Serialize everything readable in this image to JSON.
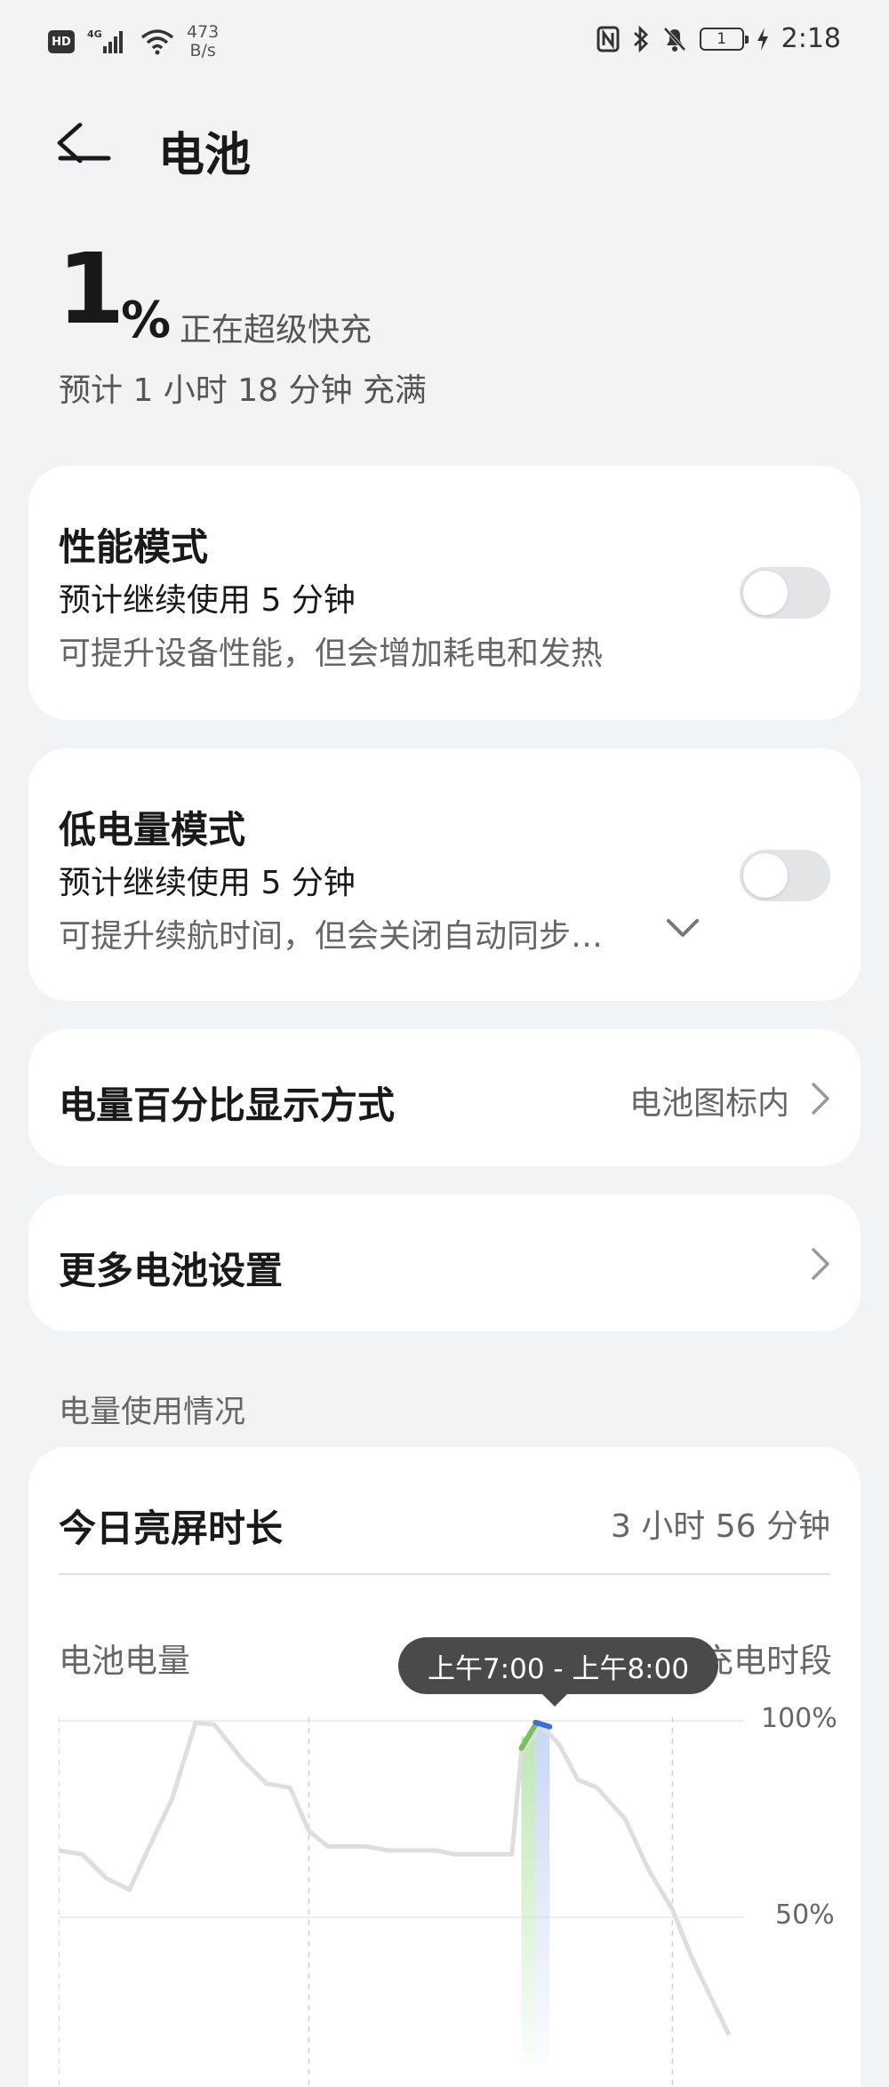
{
  "status_bar": {
    "hd": "HD",
    "network": "4G",
    "net_speed": "473",
    "net_speed_unit": "B/s",
    "battery_level": "1",
    "time": "2:18"
  },
  "header": {
    "title": "电池"
  },
  "battery": {
    "percent": "1",
    "percent_sign": "%",
    "status": "正在超级快充",
    "estimate": "预计 1 小时 18 分钟 充满"
  },
  "performance_mode": {
    "title": "性能模式",
    "subtitle": "预计继续使用 5 分钟",
    "description": "可提升设备性能，但会增加耗电和发热",
    "enabled": false
  },
  "low_power_mode": {
    "title": "低电量模式",
    "subtitle": "预计继续使用 5 分钟",
    "description": "可提升续航时间，但会关闭自动同步…",
    "enabled": false
  },
  "percent_display": {
    "title": "电量百分比显示方式",
    "value": "电池图标内"
  },
  "more_settings": {
    "title": "更多电池设置"
  },
  "usage_section": {
    "header": "电量使用情况",
    "screen_time_label": "今日亮屏时长",
    "screen_time_value": "3 小时 56 分钟"
  },
  "chart_data": {
    "type": "line",
    "title": "电池电量",
    "legend": [
      {
        "name": "充电时段",
        "color": "#bfe7b5"
      }
    ],
    "y_ticks": [
      "100%",
      "50%"
    ],
    "ylim": [
      0,
      100
    ],
    "tooltip": "上午7:00 - 上午8:00",
    "series": [
      {
        "values": [
          [
            0,
            67
          ],
          [
            0.5,
            66
          ],
          [
            1.0,
            60
          ],
          [
            1.5,
            57
          ],
          [
            2.0,
            70
          ],
          [
            2.4,
            80
          ],
          [
            2.9,
            99.5
          ],
          [
            3.3,
            99
          ],
          [
            3.9,
            90
          ],
          [
            4.4,
            84
          ],
          [
            4.9,
            83
          ],
          [
            5.3,
            72
          ],
          [
            5.7,
            68
          ],
          [
            6.2,
            68
          ],
          [
            6.5,
            68
          ],
          [
            7.0,
            67
          ],
          [
            7.5,
            67
          ],
          [
            8.0,
            67
          ],
          [
            8.4,
            66
          ],
          [
            9.0,
            66
          ],
          [
            9.6,
            66
          ],
          [
            9.8,
            92
          ],
          [
            10.2,
            99
          ],
          [
            10.6,
            94
          ],
          [
            11.0,
            85
          ],
          [
            11.4,
            83
          ],
          [
            12.0,
            75
          ],
          [
            12.5,
            62
          ],
          [
            13.0,
            52
          ],
          [
            13.4,
            40
          ],
          [
            13.8,
            30
          ],
          [
            14.2,
            20
          ]
        ],
        "color": "#dedede"
      }
    ],
    "charging_x": [
      9.8,
      10.1
    ],
    "charge_line_color": "#7bbf5c",
    "highlight_x": [
      10.1,
      10.4
    ],
    "highlight_color": "#3b6fd9",
    "highlight_fill": "#c9d7f5",
    "gridlines_vertical": [
      0,
      5.3,
      13
    ]
  }
}
